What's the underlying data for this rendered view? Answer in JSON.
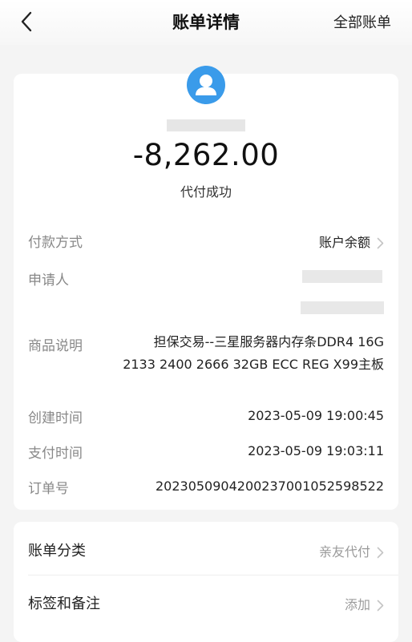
{
  "header": {
    "title": "账单详情",
    "right_action": "全部账单"
  },
  "summary": {
    "amount": "-8,262.00",
    "status": "代付成功"
  },
  "details": {
    "payment_method": {
      "label": "付款方式",
      "value": "账户余额"
    },
    "applicant": {
      "label": "申请人"
    },
    "product": {
      "label": "商品说明",
      "value": "担保交易--三星服务器内存条DDR4 16G 2133 2400 2666 32GB ECC REG X99主板"
    },
    "created_time": {
      "label": "创建时间",
      "value": "2023-05-09 19:00:45"
    },
    "paid_time": {
      "label": "支付时间",
      "value": "2023-05-09 19:03:11"
    },
    "order_no": {
      "label": "订单号",
      "value": "2023050904200237001052598522"
    }
  },
  "extra": {
    "category": {
      "label": "账单分类",
      "value": "亲友代付"
    },
    "tags": {
      "label": "标签和备注",
      "value": "添加"
    }
  },
  "colors": {
    "avatar_blue": "#3a9bea",
    "chevron": "#c4c4c4",
    "placeholder": "#e6e6e6"
  },
  "icons": {
    "back": "chevron-left-icon",
    "avatar": "user-avatar-icon",
    "chevron": "chevron-right-icon"
  }
}
